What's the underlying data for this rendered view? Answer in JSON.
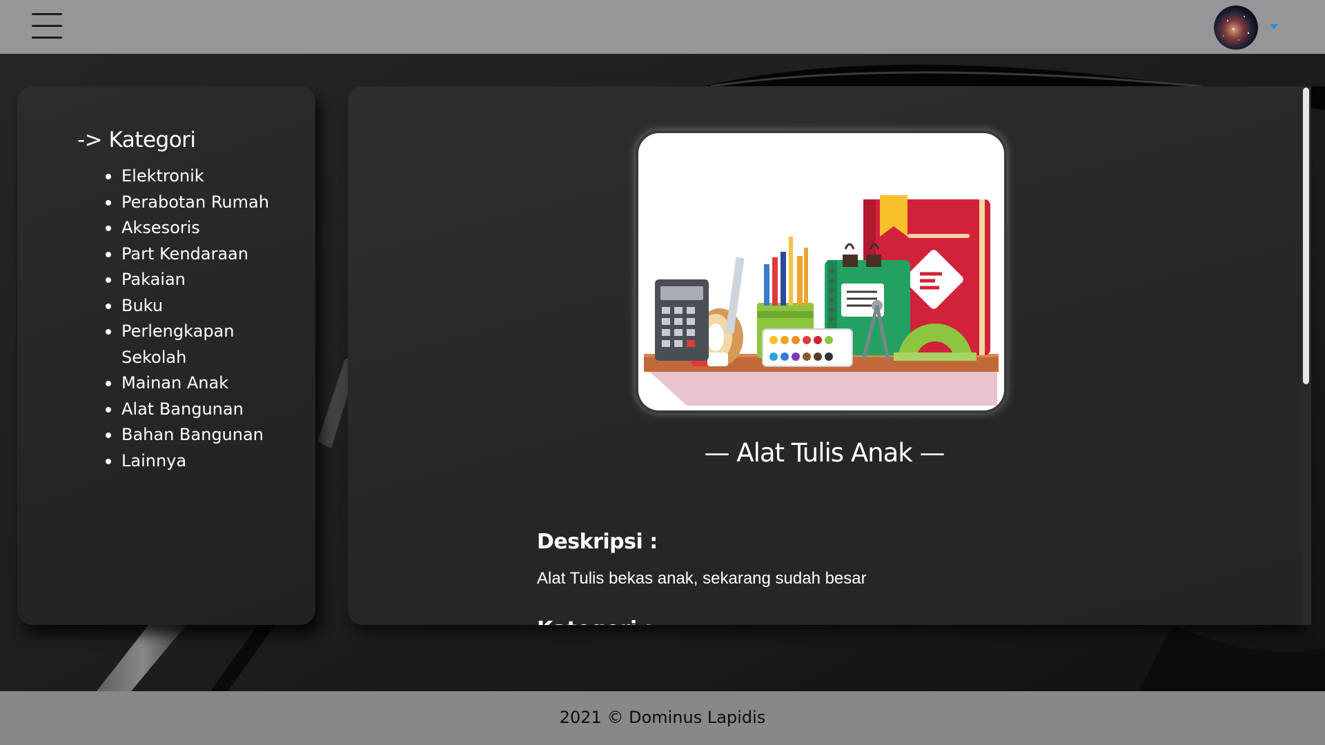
{
  "header": {
    "menu_icon": "hamburger-menu-icon",
    "avatar_icon": "user-avatar",
    "dropdown_icon": "caret-down-icon",
    "accent_color": "#1e8ef0"
  },
  "sidebar": {
    "title": "-> Kategori",
    "items": [
      "Elektronik",
      "Perabotan Rumah",
      "Aksesoris",
      "Part Kendaraan",
      "Pakaian",
      "Buku",
      "Perlengkapan Sekolah",
      "Mainan Anak",
      "Alat Bangunan",
      "Bahan Bangunan",
      "Lainnya"
    ]
  },
  "product": {
    "image_icon": "stationery-illustration",
    "title": "— Alat Tulis Anak —",
    "description_label": "Deskripsi :",
    "description": "Alat Tulis bekas anak, sekarang sudah besar",
    "category_label": "Kategori :"
  },
  "footer": {
    "text": "2021 © Dominus Lapidis"
  }
}
